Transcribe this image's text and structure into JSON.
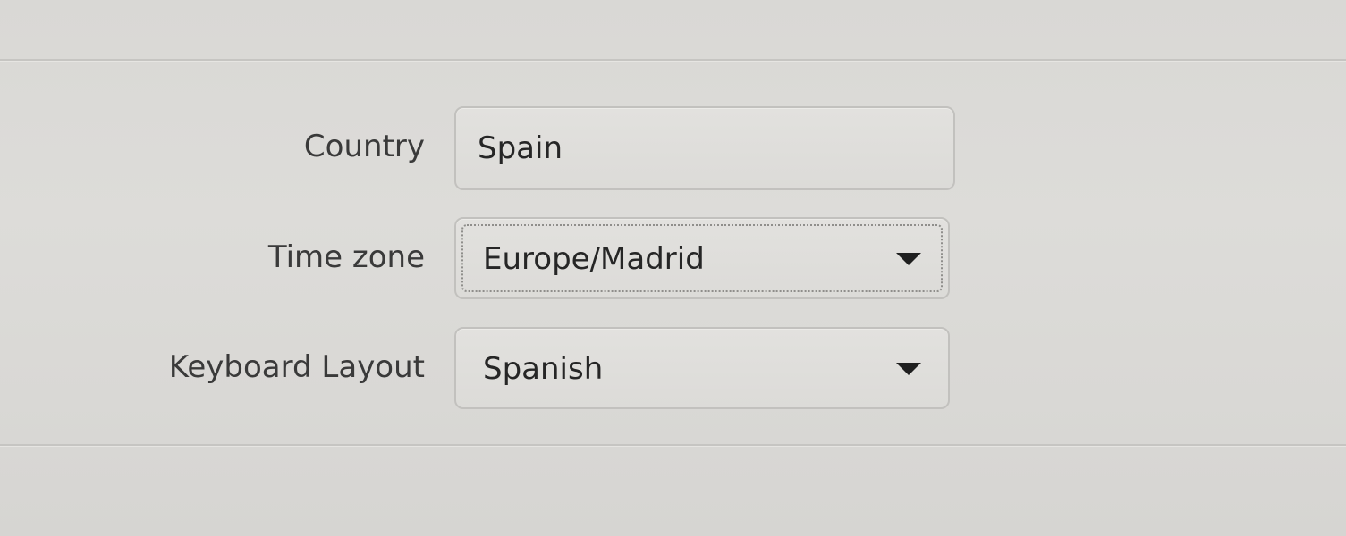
{
  "form": {
    "country": {
      "label": "Country",
      "value": "Spain"
    },
    "time_zone": {
      "label": "Time zone",
      "value": "Europe/Madrid",
      "icon": "chevron-down-icon"
    },
    "keyboard_layout": {
      "label": "Keyboard Layout",
      "value": "Spanish",
      "icon": "chevron-down-icon"
    }
  },
  "colors": {
    "background": "#dbdad7",
    "field_border": "#c2c1be",
    "text": "#2b2b2b"
  }
}
